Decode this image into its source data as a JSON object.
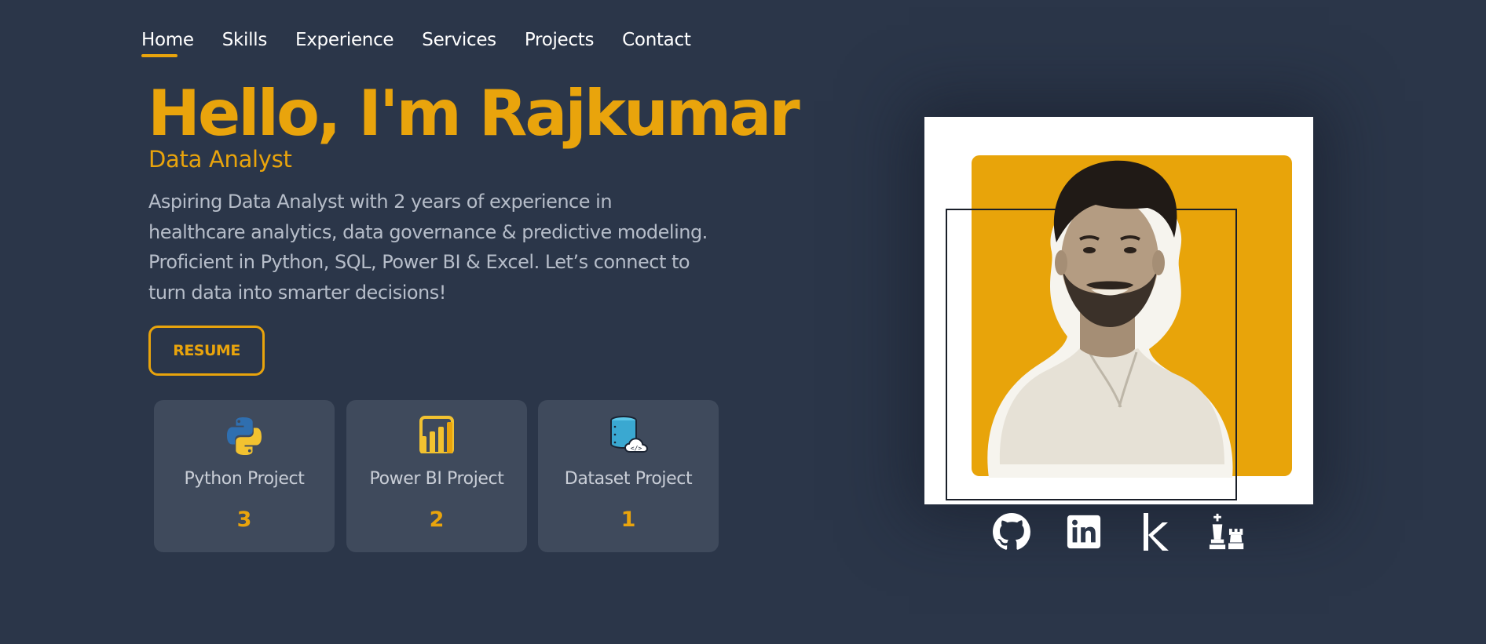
{
  "nav": {
    "items": [
      {
        "label": "Home"
      },
      {
        "label": "Skills"
      },
      {
        "label": "Experience"
      },
      {
        "label": "Services"
      },
      {
        "label": "Projects"
      },
      {
        "label": "Contact"
      }
    ],
    "active": "Home"
  },
  "hero": {
    "title": "Hello, I'm Rajkumar",
    "role": "Data Analyst",
    "description": "Aspiring Data Analyst with 2 years of experience in healthcare analytics, data governance & predictive modeling. Proficient in Python, SQL, Power BI & Excel. Let’s connect to turn data into smarter decisions!",
    "resume_label": "RESUME"
  },
  "stats": [
    {
      "label": "Python Project",
      "count": "3",
      "icon": "python-icon"
    },
    {
      "label": "Power BI Project",
      "count": "2",
      "icon": "power-bi-icon"
    },
    {
      "label": "Dataset Project",
      "count": "1",
      "icon": "database-icon"
    }
  ],
  "profile": {
    "photo": "profile-photo"
  },
  "social": [
    {
      "icon": "github-icon"
    },
    {
      "icon": "linkedin-icon"
    },
    {
      "icon": "kaggle-icon"
    },
    {
      "icon": "chess-icon"
    }
  ],
  "colors": {
    "background": "#2b3649",
    "accent": "#e9a40c",
    "card": "#3f4a5c",
    "muted_text": "#b6bdc9"
  }
}
